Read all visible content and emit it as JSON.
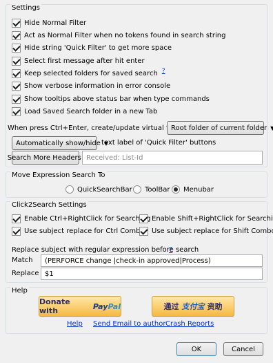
{
  "settings": {
    "title": "Settings",
    "checkboxes": [
      {
        "label": "Hide Normal Filter",
        "checked": true
      },
      {
        "label": "Act as Normal Filter when no tokens found in search string",
        "checked": true
      },
      {
        "label": "Hide string 'Quick Filter' to get more space",
        "checked": true
      },
      {
        "label": "Select first message after hit enter",
        "checked": true
      },
      {
        "label": "Keep selected folders for saved search",
        "checked": true
      },
      {
        "label": "Show verbose information in error console",
        "checked": true
      },
      {
        "label": "Show tooltips above status bar when type commands",
        "checked": true
      },
      {
        "label": "Load Saved Search folder in a new Tab",
        "checked": true
      }
    ],
    "keep_folders_help": "?",
    "ctrl_enter_label": "When press Ctrl+Enter, create/update virtual folder in:",
    "ctrl_enter_value": "Root folder of current folder",
    "qf_mode_value": "Automatically show/hide",
    "qf_mode_suffix": "text label of 'Quick Filter' buttons",
    "search_headers_button": "Search More Headers:",
    "search_headers_placeholder": "Received: List-Id"
  },
  "move": {
    "title": "Move Expression Search To",
    "options": [
      {
        "label": "QuickSearchBar",
        "selected": false
      },
      {
        "label": "ToolBar",
        "selected": false
      },
      {
        "label": "Menubar",
        "selected": true
      }
    ]
  },
  "click2search": {
    "title": "Click2Search Settings",
    "checkboxes": [
      {
        "label": "Enable Ctrl+RightClick for Searching",
        "checked": true
      },
      {
        "label": "Enable Shift+RightClick for Searching",
        "checked": true
      },
      {
        "label": "Use subject replace for Ctrl Combo",
        "checked": true
      },
      {
        "label": "Use subject replace for Shift Combo",
        "checked": true
      }
    ],
    "replace_label": "Replace subject with regular expression before search",
    "replace_help": "?",
    "match_label": "Match",
    "match_value": "(PERFORCE change |check-in approved|Process)",
    "replace_field_label": "Replace",
    "replace_value": "$1"
  },
  "help": {
    "title": "Help",
    "donate_paypal_prefix": "Donate with",
    "paypal_pay": "Pay",
    "paypal_pal": "Pal",
    "donate_alipay_prefix": "通过",
    "alipay_name": "支付宝",
    "donate_alipay_suffix": "资助",
    "links": [
      "Help",
      "Send Email to author",
      "Crash Reports"
    ]
  },
  "dialog": {
    "ok": "OK",
    "cancel": "Cancel"
  }
}
